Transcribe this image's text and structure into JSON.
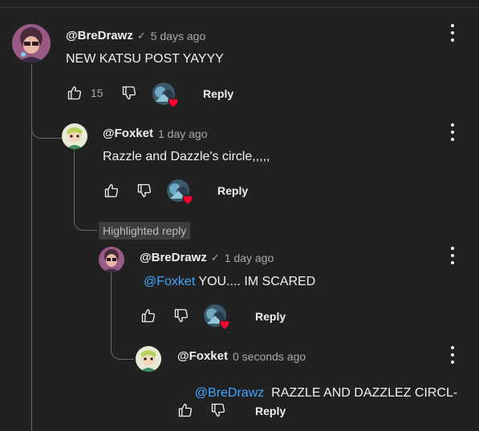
{
  "comments": [
    {
      "author": "@BreDrawz",
      "verified": true,
      "time": "5 days ago",
      "text": "NEW KATSU POST YAYYY",
      "likes": "15",
      "reply_label": "Reply"
    },
    {
      "author": "@Foxket",
      "verified": false,
      "time": "1 day ago",
      "text": "Razzle and Dazzle's circle,,,,,",
      "reply_label": "Reply"
    },
    {
      "author": "@BreDrawz",
      "verified": true,
      "time": "1 day ago",
      "mention": "@Foxket",
      "text": " YOU.... IM SCARED",
      "reply_label": "Reply"
    },
    {
      "author": "@Foxket",
      "verified": false,
      "time": "0 seconds ago",
      "mention": "@BreDrawz",
      "text": "  RAZZLE AND DAZZLEZ CIRCL-",
      "reply_label": "Reply"
    }
  ],
  "highlighted_label": "Highlighted reply",
  "check_glyph": "✓",
  "colors": {
    "background": "#212121",
    "mention": "#3ea6ff",
    "heart": "#ff0033"
  },
  "icons": [
    "thumbs-up-icon",
    "thumbs-down-icon",
    "heart-icon",
    "more-vert-icon"
  ]
}
